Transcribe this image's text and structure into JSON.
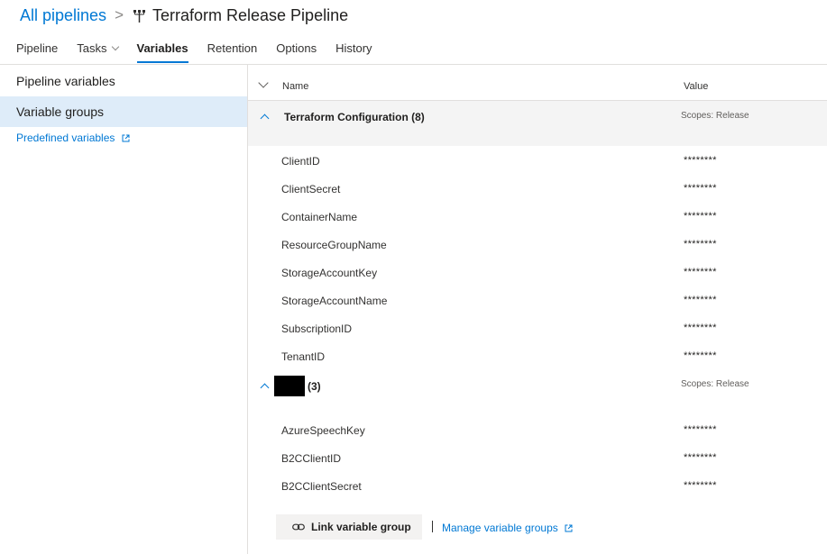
{
  "header": {
    "breadcrumb_root": "All pipelines",
    "breadcrumb_separator": ">",
    "title": "Terraform Release Pipeline",
    "title_icon": "release-pipeline-icon"
  },
  "tabs": [
    {
      "label": "Pipeline"
    },
    {
      "label": "Tasks",
      "has_dropdown": true
    },
    {
      "label": "Variables",
      "active": true
    },
    {
      "label": "Retention"
    },
    {
      "label": "Options"
    },
    {
      "label": "History"
    }
  ],
  "sidebar": {
    "items": [
      {
        "label": "Pipeline variables"
      },
      {
        "label": "Variable groups",
        "selected": true
      }
    ],
    "link": {
      "label": "Predefined variables",
      "icon": "external-link-icon"
    }
  },
  "grid": {
    "columns": {
      "name": "Name",
      "value": "Value"
    },
    "groups": [
      {
        "name": "Terraform Configuration (8)",
        "scope": "Scopes: Release",
        "variables": [
          {
            "name": "ClientID",
            "value": "********"
          },
          {
            "name": "ClientSecret",
            "value": "********"
          },
          {
            "name": "ContainerName",
            "value": "********"
          },
          {
            "name": "ResourceGroupName",
            "value": "********"
          },
          {
            "name": "StorageAccountKey",
            "value": "********"
          },
          {
            "name": "StorageAccountName",
            "value": "********"
          },
          {
            "name": "SubscriptionID",
            "value": "********"
          },
          {
            "name": "TenantID",
            "value": "********"
          }
        ]
      },
      {
        "name_redacted": true,
        "count": "(3)",
        "scope": "Scopes: Release",
        "variables": [
          {
            "name": "AzureSpeechKey",
            "value": "********"
          },
          {
            "name": "B2CClientID",
            "value": "********"
          },
          {
            "name": "B2CClientSecret",
            "value": "********"
          }
        ]
      }
    ]
  },
  "actions": {
    "link_group": {
      "label": "Link variable group",
      "icon": "link-icon"
    },
    "separator": "|",
    "manage_groups": {
      "label": "Manage variable groups",
      "icon": "external-link-icon"
    }
  },
  "colors": {
    "accent": "#0078d4",
    "selected_bg": "#deecf9",
    "group_bg": "#f4f4f4",
    "redaction": "#000000"
  }
}
